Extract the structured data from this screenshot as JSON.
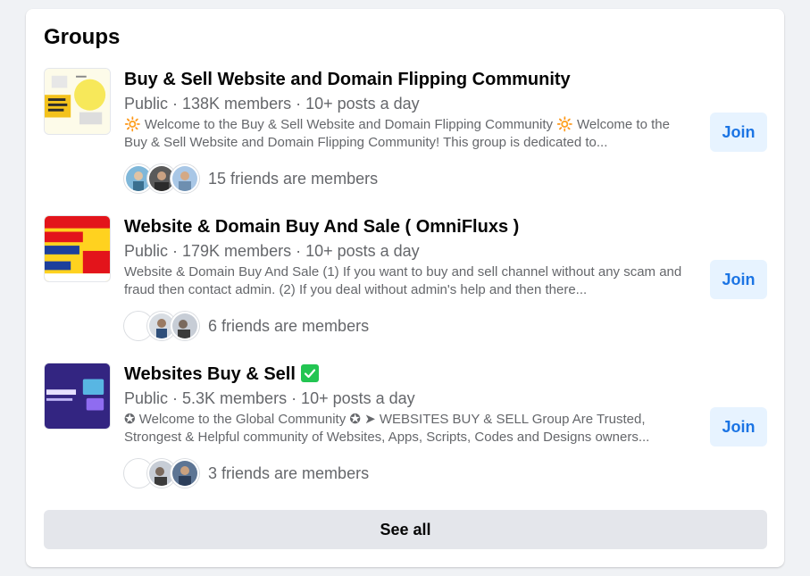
{
  "section": {
    "title": "Groups",
    "see_all_label": "See all"
  },
  "groups": [
    {
      "name": "Buy & Sell Website and Domain Flipping Community",
      "meta": "Public · 138K members · 10+ posts a day",
      "description": "🔆 Welcome to the Buy & Sell Website and Domain Flipping Community 🔆 Welcome to the Buy & Sell Website and Domain Flipping Community! This group is dedicated to...",
      "friends_text": "15 friends are members",
      "join_label": "Join",
      "verified": false
    },
    {
      "name": "Website & Domain Buy And Sale ( OmniFluxs )",
      "meta": "Public · 179K members · 10+ posts a day",
      "description": "Website & Domain Buy And Sale (1) If you want to buy and sell channel without any scam and fraud then contact admin. (2) If you deal without admin's help and then there...",
      "friends_text": "6 friends are members",
      "join_label": "Join",
      "verified": false
    },
    {
      "name": "Websites Buy & Sell",
      "meta": "Public · 5.3K members · 10+ posts a day",
      "description": "✪ Welcome to the Global Community ✪ ➤ WEBSITES BUY & SELL Group Are Trusted, Strongest & Helpful community of Websites, Apps, Scripts, Codes and Designs owners...",
      "friends_text": "3 friends are members",
      "join_label": "Join",
      "verified": true
    }
  ],
  "colors": {
    "join_bg": "#e7f3ff",
    "join_text": "#1b74e4",
    "verified": "#23c552",
    "see_all_bg": "#e4e6eb"
  },
  "icons": {
    "verified": "check-badge-icon"
  }
}
